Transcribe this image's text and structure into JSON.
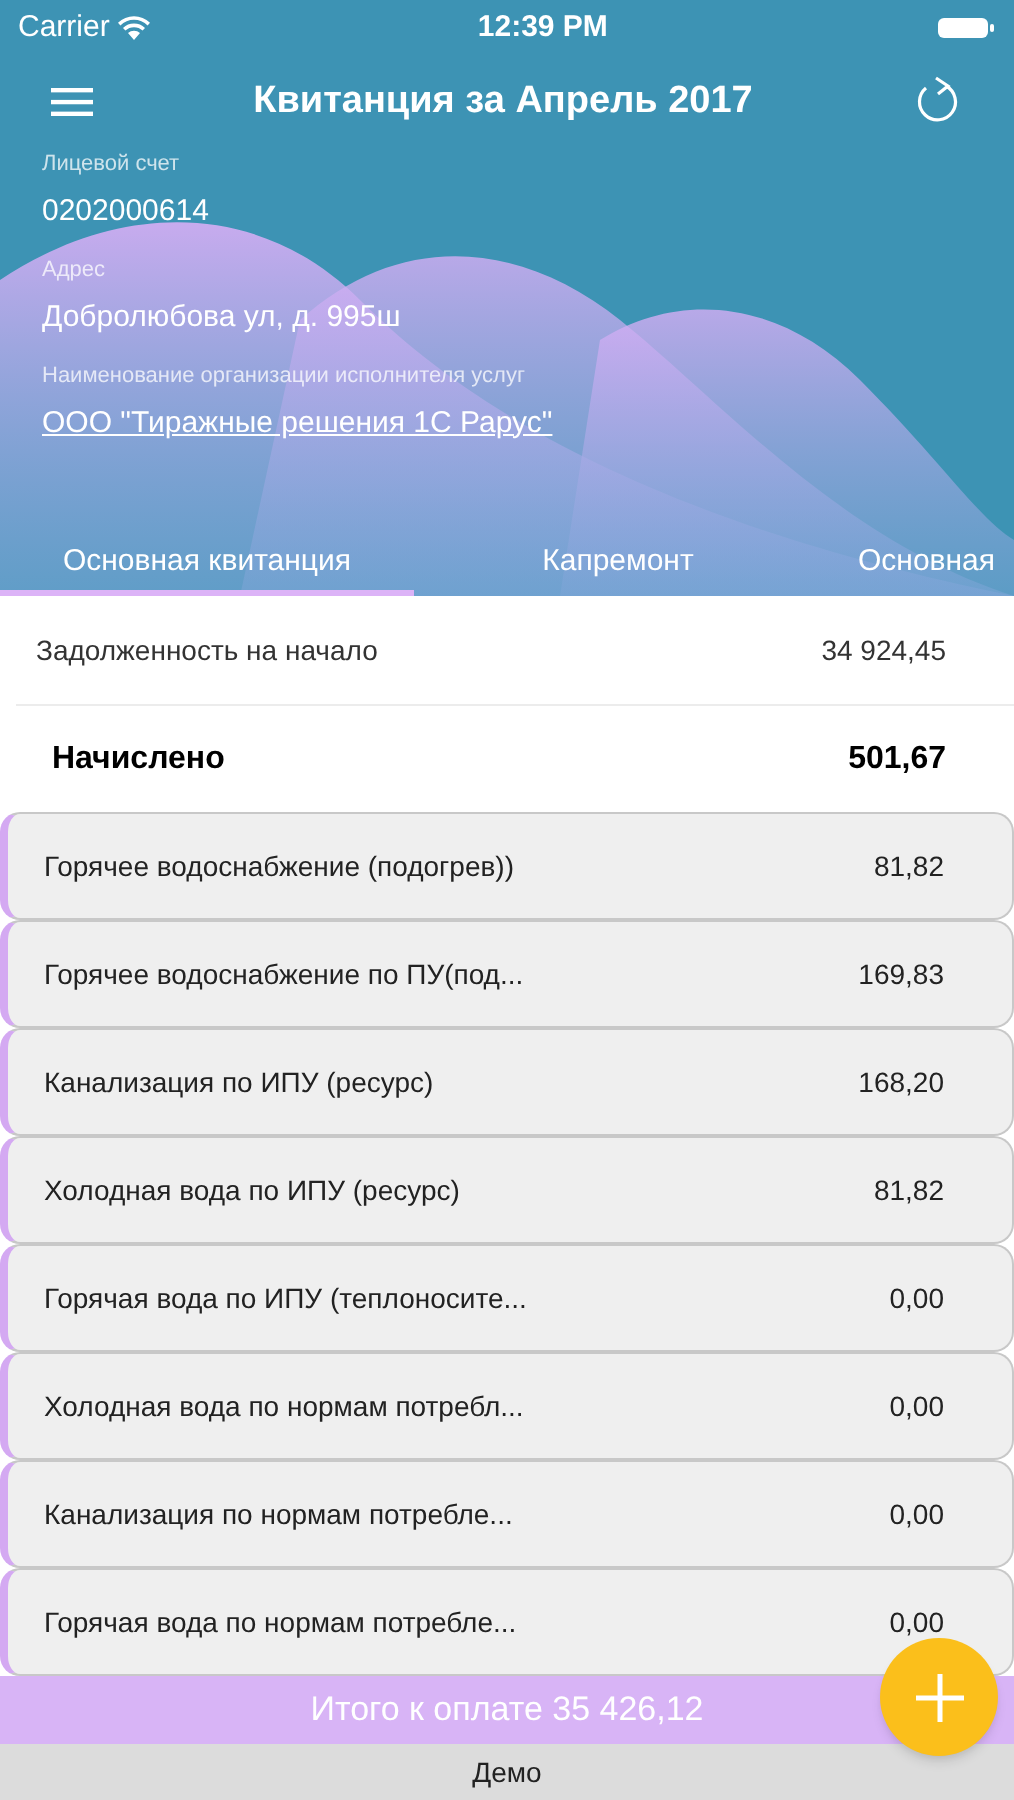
{
  "status_bar": {
    "carrier": "Carrier",
    "time": "12:39 PM"
  },
  "nav": {
    "title": "Квитанция за Апрель 2017"
  },
  "info": [
    {
      "label": "Лицевой счет",
      "value": "0202000614",
      "kind": "text"
    },
    {
      "label": "Адрес",
      "value": "Добролюбова ул, д. 995ш",
      "kind": "text"
    },
    {
      "label": "Наименование организации исполнителя услуг",
      "value": "ООО \"Тиражные решения 1С Рарус\"",
      "kind": "link"
    }
  ],
  "tabs": [
    {
      "label": "Основная квитанция",
      "selected": true
    },
    {
      "label": "Капремонт",
      "selected": false
    },
    {
      "label": "Основная",
      "selected": false
    }
  ],
  "summary": [
    {
      "label": "Задолженность на начало",
      "value": "34 924,45",
      "kind": "plain"
    },
    {
      "label": "Начислено",
      "value": "501,67",
      "kind": "bold"
    }
  ],
  "services": [
    {
      "name": "Горячее водоснабжение (подогрев))",
      "amount": "81,82"
    },
    {
      "name": "Горячее водоснабжение по ПУ(под...",
      "amount": "169,83"
    },
    {
      "name": "Канализация по ИПУ (ресурс)",
      "amount": "168,20"
    },
    {
      "name": "Холодная вода по ИПУ (ресурс)",
      "amount": "81,82"
    },
    {
      "name": "Горячая вода по ИПУ (теплоносите...",
      "amount": "0,00"
    },
    {
      "name": "Холодная вода по нормам потребл...",
      "amount": "0,00"
    },
    {
      "name": "Канализация по нормам потребле...",
      "amount": "0,00"
    },
    {
      "name": "Горячая вода по нормам потребле...",
      "amount": "0,00"
    }
  ],
  "total": "Итого к оплате 35 426,12",
  "footer": "Демо"
}
